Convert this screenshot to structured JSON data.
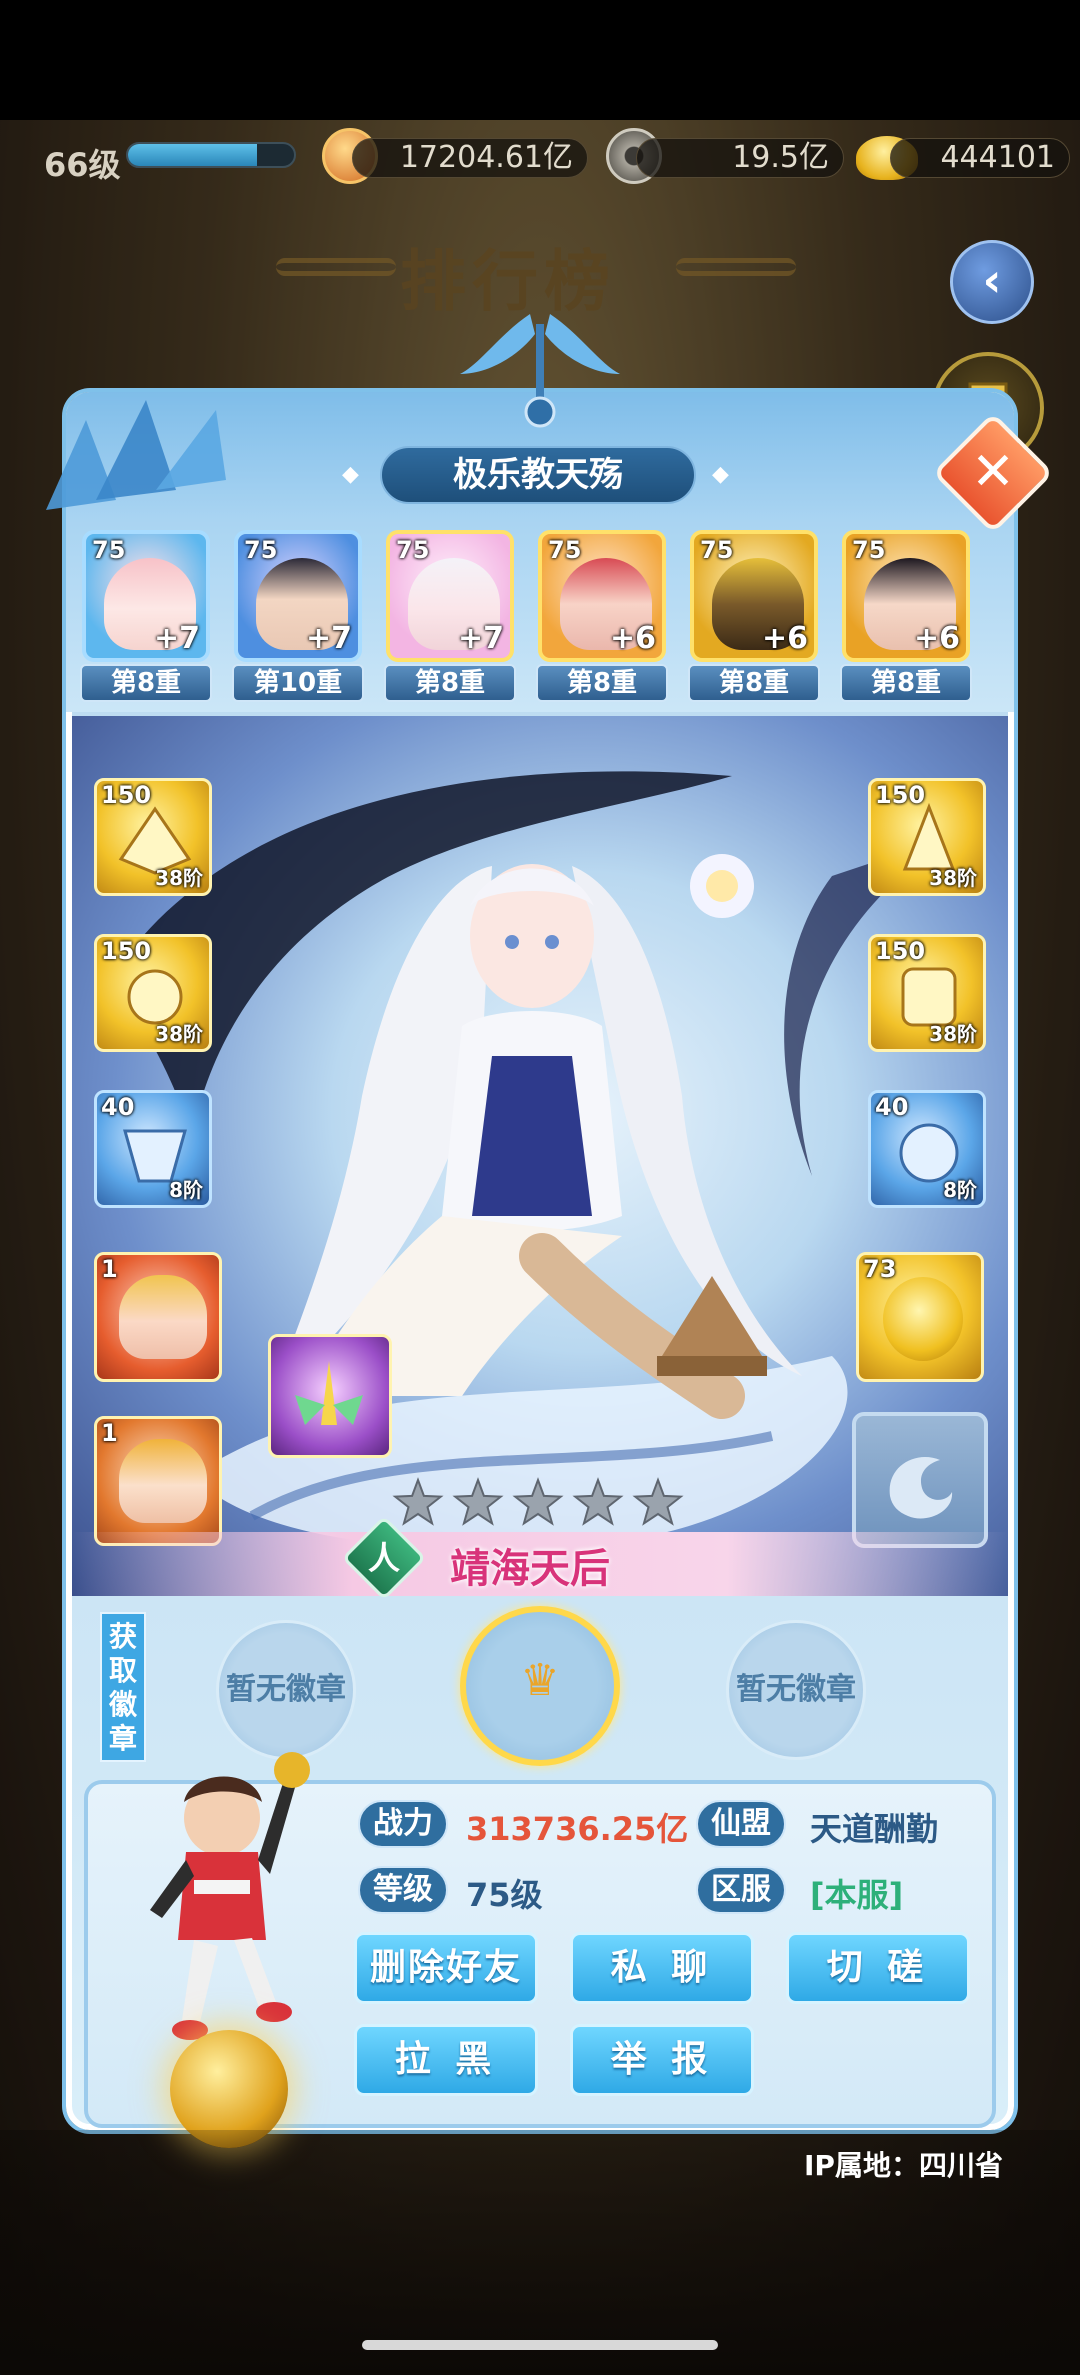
{
  "resources": {
    "level": "66级",
    "level_progress": 0.78,
    "gold": "17204.61亿",
    "coins": "19.5亿",
    "ingots": "444101"
  },
  "screen_title": "排行榜",
  "player": {
    "team_name": "极乐教天殇",
    "team": [
      {
        "level": "75",
        "bonus": "+7",
        "tier": "第8重"
      },
      {
        "level": "75",
        "bonus": "+7",
        "tier": "第10重"
      },
      {
        "level": "75",
        "bonus": "+7",
        "tier": "第8重"
      },
      {
        "level": "75",
        "bonus": "+6",
        "tier": "第8重"
      },
      {
        "level": "75",
        "bonus": "+6",
        "tier": "第8重"
      },
      {
        "level": "75",
        "bonus": "+6",
        "tier": "第8重"
      }
    ],
    "equip_left": [
      {
        "level": "150",
        "stage": "38阶"
      },
      {
        "level": "150",
        "stage": "38阶"
      },
      {
        "level": "40",
        "stage": "8阶"
      },
      {
        "level": "1",
        "stage": ""
      },
      {
        "level": "1",
        "stage": ""
      }
    ],
    "equip_right": [
      {
        "level": "150",
        "stage": "38阶"
      },
      {
        "level": "150",
        "stage": "38阶"
      },
      {
        "level": "40",
        "stage": "8阶"
      },
      {
        "level": "73",
        "stage": ""
      }
    ],
    "hero": {
      "name": "靖海天后",
      "faction": "人",
      "stars": 5
    },
    "badges": {
      "side_label": "获取徽章",
      "empty_left": "暂无徽章",
      "empty_right": "暂无徽章"
    },
    "stats": {
      "power_label": "战力",
      "power_value": "313736.25亿",
      "guild_label": "仙盟",
      "guild_value": "天道酬勤",
      "level_label": "等级",
      "level_value": "75级",
      "server_label": "区服",
      "server_value": "[本服]"
    },
    "actions": {
      "delete_friend": "删除好友",
      "private_chat": "私 聊",
      "duel": "切 磋",
      "block": "拉 黑",
      "report": "举 报"
    },
    "ip_location": "IP属地：四川省"
  },
  "colors": {
    "power": "#e5553a",
    "guild": "#2c5a86",
    "server": "#2db07a",
    "accent": "#2fa9e6",
    "hero_name": "#d8337a"
  },
  "icons": {
    "gold": "gold-ingot-icon",
    "coins": "copper-coin-icon",
    "ingots": "yuanbao-icon",
    "back": "back-arrow-icon",
    "close": "close-icon",
    "trophy": "trophy-icon",
    "dragon": "dragon-crest-icon"
  }
}
